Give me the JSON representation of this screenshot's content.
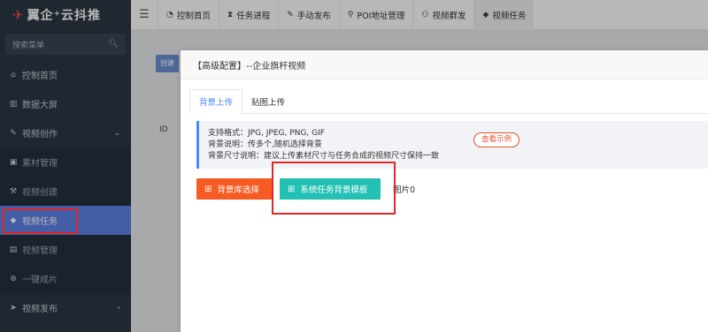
{
  "brand": {
    "mark": "✈",
    "name": "翼企⁺云抖推"
  },
  "search": {
    "placeholder": "搜索菜单",
    "icon": "search-icon"
  },
  "sidebar": {
    "items": [
      {
        "label": "控制首页",
        "icon": "home-icon"
      },
      {
        "label": "数据大屏",
        "icon": "bar-chart-icon"
      },
      {
        "label": "视频创作",
        "icon": "pencil-icon",
        "arrow": "⌄"
      },
      {
        "label": "素材管理",
        "icon": "image-icon"
      },
      {
        "label": "视频创建",
        "icon": "wrench-icon"
      },
      {
        "label": "视频任务",
        "icon": "tag-icon"
      },
      {
        "label": "视频管理",
        "icon": "film-icon"
      },
      {
        "label": "一键成片",
        "icon": "plus-circle-icon"
      },
      {
        "label": "视频发布",
        "icon": "send-icon",
        "arrow": "‹"
      }
    ]
  },
  "topnav": {
    "tabs": [
      {
        "label": "控制首页",
        "icon": "dashboard-icon"
      },
      {
        "label": "任务进程",
        "icon": "hourglass-icon"
      },
      {
        "label": "手动发布",
        "icon": "edit-icon"
      },
      {
        "label": "POI地址管理",
        "icon": "map-pin-icon"
      },
      {
        "label": "视频群发",
        "icon": "users-icon"
      },
      {
        "label": "视频任务",
        "icon": "tag-icon"
      }
    ]
  },
  "background": {
    "button_label": "创建",
    "id_label": "ID"
  },
  "modal": {
    "title": "【高级配置】--企业旗杆视频",
    "tabs": [
      "背景上传",
      "贴图上传"
    ],
    "info": {
      "line1": "支持格式：JPG, JPEG, PNG, GIF",
      "line2": "背景说明：传多个,随机选择背景",
      "line3": "背景尺寸说明：建议上传素材尺寸与任务合成的视频尺寸保持一致",
      "example_label": "查看示例"
    },
    "btn_library": "背景库选择",
    "btn_system": "系统任务背景模板",
    "image_count": "图片0"
  },
  "colors": {
    "sidebar_bg": "#2b3643",
    "active_item": "#5e83e6",
    "orange_button": "#f55b23",
    "teal_button": "#22c1b3",
    "highlight_red": "#e0282a",
    "tab_active": "#4a8af4"
  }
}
